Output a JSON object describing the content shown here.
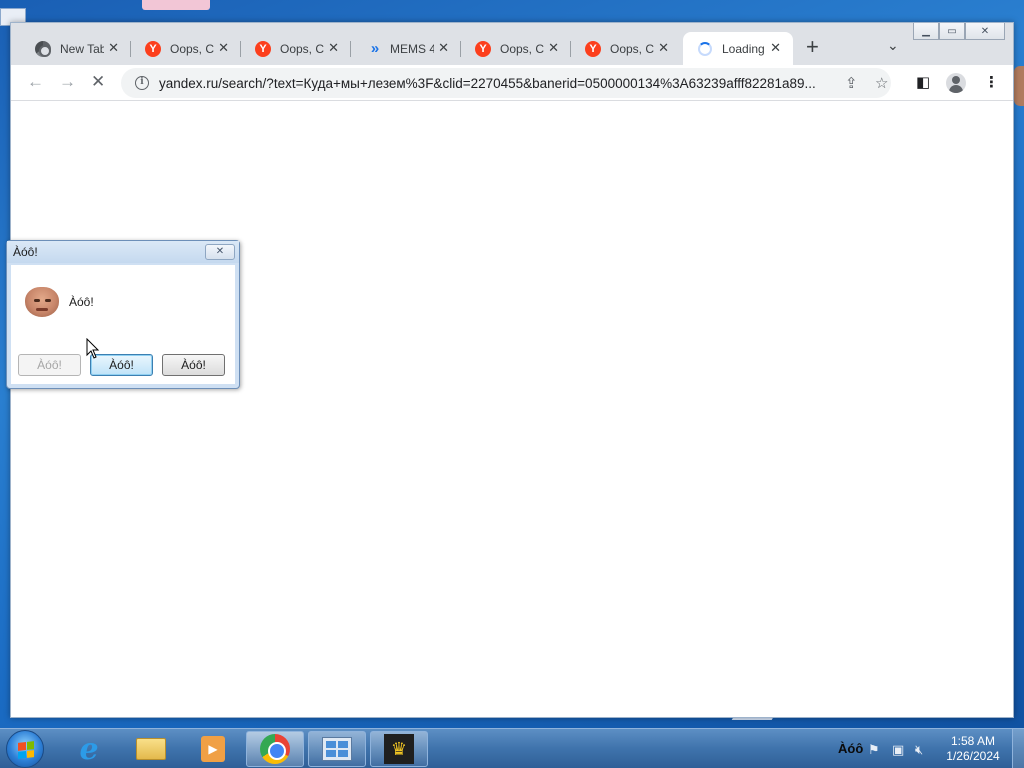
{
  "browser": {
    "tabs": [
      {
        "title": "New Tab",
        "icon": "chrome-icon",
        "active": false
      },
      {
        "title": "Oops, Ca",
        "icon": "yandex-icon",
        "active": false
      },
      {
        "title": "Oops, Ca",
        "icon": "yandex-icon",
        "active": false
      },
      {
        "title": "MEMS 4",
        "icon": "mems-icon",
        "active": false
      },
      {
        "title": "Oops, Ca",
        "icon": "yandex-icon",
        "active": false
      },
      {
        "title": "Oops, Ca",
        "icon": "yandex-icon",
        "active": false
      },
      {
        "title": "Loading",
        "icon": "loading-spinner-icon",
        "active": true
      }
    ],
    "close_glyph": "✕",
    "new_tab_glyph": "+",
    "tab_search_glyph": "⌄",
    "yandex_letter": "Y",
    "address": {
      "url": "yandex.ru/search/?text=Куда+мы+лезем%3F&clid=2270455&banerid=0500000134%3A63239afff82281a89..."
    },
    "toolbar": {
      "back_glyph": "←",
      "forward_glyph": "→",
      "stop_glyph": "✕",
      "share_glyph": "⇪",
      "star_glyph": "☆",
      "sidepanel_glyph": "◧",
      "menu_glyph": "⋮"
    }
  },
  "dialog": {
    "title": "Àóô!",
    "message": "Àóô!",
    "buttons": [
      {
        "label": "Àóô!",
        "state": "disabled"
      },
      {
        "label": "Àóô!",
        "state": "default"
      },
      {
        "label": "Àóô!",
        "state": "normal"
      }
    ]
  },
  "taskbar": {
    "items": [
      "internet-explorer-icon",
      "file-explorer-icon",
      "media-player-icon",
      "chrome-icon",
      "control-panel-icon",
      "crown-app-icon"
    ],
    "tray_text": "Àóô",
    "clock": {
      "time": "1:58 AM",
      "date": "1/26/2024"
    }
  },
  "colors": {
    "accent": "#1a73e8",
    "yandex": "#fc3f1d",
    "taskbar": "#3f73ac"
  }
}
